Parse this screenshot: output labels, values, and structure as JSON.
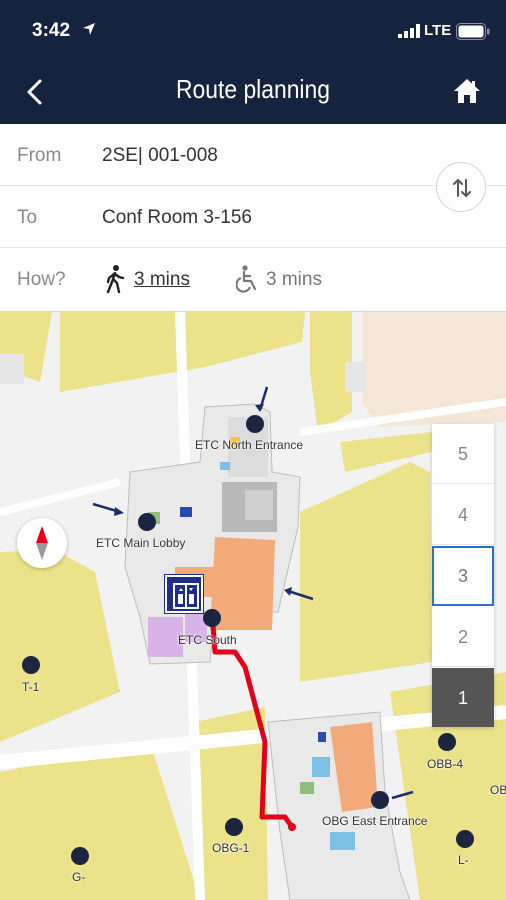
{
  "status_bar": {
    "time": "3:42",
    "network": "LTE"
  },
  "nav": {
    "title": "Route planning",
    "back_icon": "chevron-left-icon",
    "home_icon": "home-icon"
  },
  "form": {
    "from_label": "From",
    "from_value": "2SE| 001-008",
    "to_label": "To",
    "to_value": "Conf Room  3-156",
    "how_label": "How?",
    "modes": [
      {
        "icon": "walk-icon",
        "label": "3 mins",
        "selected": true
      },
      {
        "icon": "wheelchair-icon",
        "label": "3 mins",
        "selected": false
      }
    ],
    "swap_icon": "swap-vertical-icon"
  },
  "map": {
    "labels": {
      "etc_north": "ETC North Entrance",
      "etc_main": "ETC Main Lobby",
      "etc_south": "ETC South",
      "t1": "T-1",
      "obb4": "OBB-4",
      "obg_east": "OBG East Entrance",
      "obg1": "OBG-1",
      "g": "G-",
      "l": "L-",
      "ob": "OB"
    },
    "route_color": "#e2001a",
    "building_color": "#ece28a",
    "compass_icon": "compass-icon",
    "elevator_icon": "elevator-icon"
  },
  "floors": {
    "items": [
      "5",
      "4",
      "3",
      "2",
      "1"
    ],
    "selected": "3",
    "current": "1"
  },
  "colors": {
    "header": "#16233f",
    "accent": "#2d6fc9"
  }
}
